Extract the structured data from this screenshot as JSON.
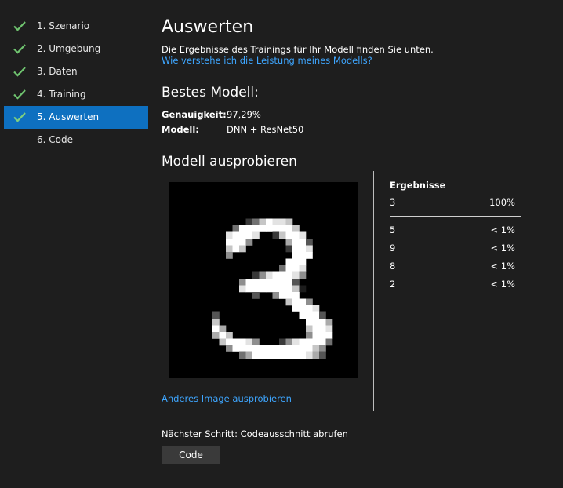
{
  "sidebar": {
    "items": [
      {
        "label": "1. Szenario",
        "done": true,
        "active": false
      },
      {
        "label": "2. Umgebung",
        "done": true,
        "active": false
      },
      {
        "label": "3. Daten",
        "done": true,
        "active": false
      },
      {
        "label": "4. Training",
        "done": true,
        "active": false
      },
      {
        "label": "5. Auswerten",
        "done": true,
        "active": true
      },
      {
        "label": "6. Code",
        "done": false,
        "active": false
      }
    ]
  },
  "main": {
    "title": "Auswerten",
    "subtitle": "Die Ergebnisse des Trainings für Ihr Modell finden Sie unten.",
    "learn_link": "Wie verstehe ich die Leistung meines Modells?",
    "best_model": {
      "heading": "Bestes Modell:",
      "accuracy_label": "Genauigkeit:",
      "accuracy_value": "97,29%",
      "model_label": "Modell:",
      "model_value": "DNN + ResNet50"
    },
    "try_model": {
      "heading": "Modell ausprobieren",
      "image_alt": "digit-3-image",
      "try_another_link": "Anderes Image ausprobieren"
    },
    "results": {
      "title": "Ergebnisse",
      "top": {
        "label": "3",
        "value": "100%"
      },
      "others": [
        {
          "label": "5",
          "value": "< 1%"
        },
        {
          "label": "9",
          "value": "< 1%"
        },
        {
          "label": "8",
          "value": "< 1%"
        },
        {
          "label": "2",
          "value": "< 1%"
        }
      ]
    },
    "next_step": {
      "text": "Nächster Schritt: Codeausschnitt abrufen",
      "button_label": "Code"
    }
  },
  "colors": {
    "background": "#1e1e1e",
    "active_nav": "#0e70c0",
    "check": "#6fc36f",
    "link": "#3ea6ff"
  }
}
